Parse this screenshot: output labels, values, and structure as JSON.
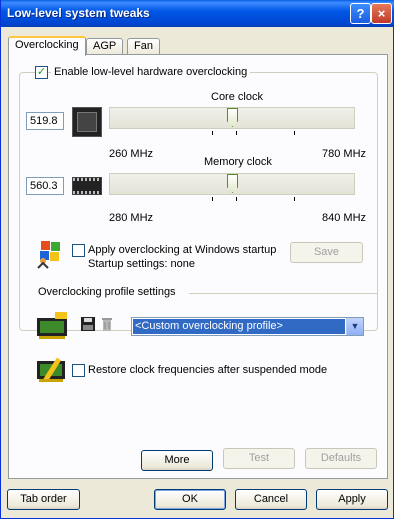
{
  "window": {
    "title": "Low-level system tweaks",
    "help_label": "?",
    "close_label": "×"
  },
  "tabs": [
    {
      "label": "Overclocking",
      "active": true
    },
    {
      "label": "AGP",
      "active": false
    },
    {
      "label": "Fan",
      "active": false
    }
  ],
  "overclocking": {
    "enable_label": "Enable low-level hardware overclocking",
    "enable_checked": true,
    "core": {
      "label": "Core clock",
      "value": "519.8",
      "min": "260 MHz",
      "max": "780 MHz",
      "position": 0.5
    },
    "memory": {
      "label": "Memory clock",
      "value": "560.3",
      "min": "280 MHz",
      "max": "840 MHz",
      "position": 0.5
    },
    "apply_startup_label": "Apply overclocking at Windows startup",
    "apply_startup_checked": false,
    "startup_settings": "Startup settings: none",
    "save_label": "Save"
  },
  "profile": {
    "group_label": "Overclocking profile settings",
    "selected": "<Custom overclocking profile>",
    "dropdown_arrow": "▼"
  },
  "restore": {
    "label": "Restore clock frequencies after suspended mode",
    "checked": false
  },
  "panel_buttons": {
    "more": "More",
    "test": "Test",
    "defaults": "Defaults"
  },
  "footer": {
    "tab_order": "Tab order",
    "ok": "OK",
    "cancel": "Cancel",
    "apply": "Apply"
  },
  "check_mark": "✓"
}
